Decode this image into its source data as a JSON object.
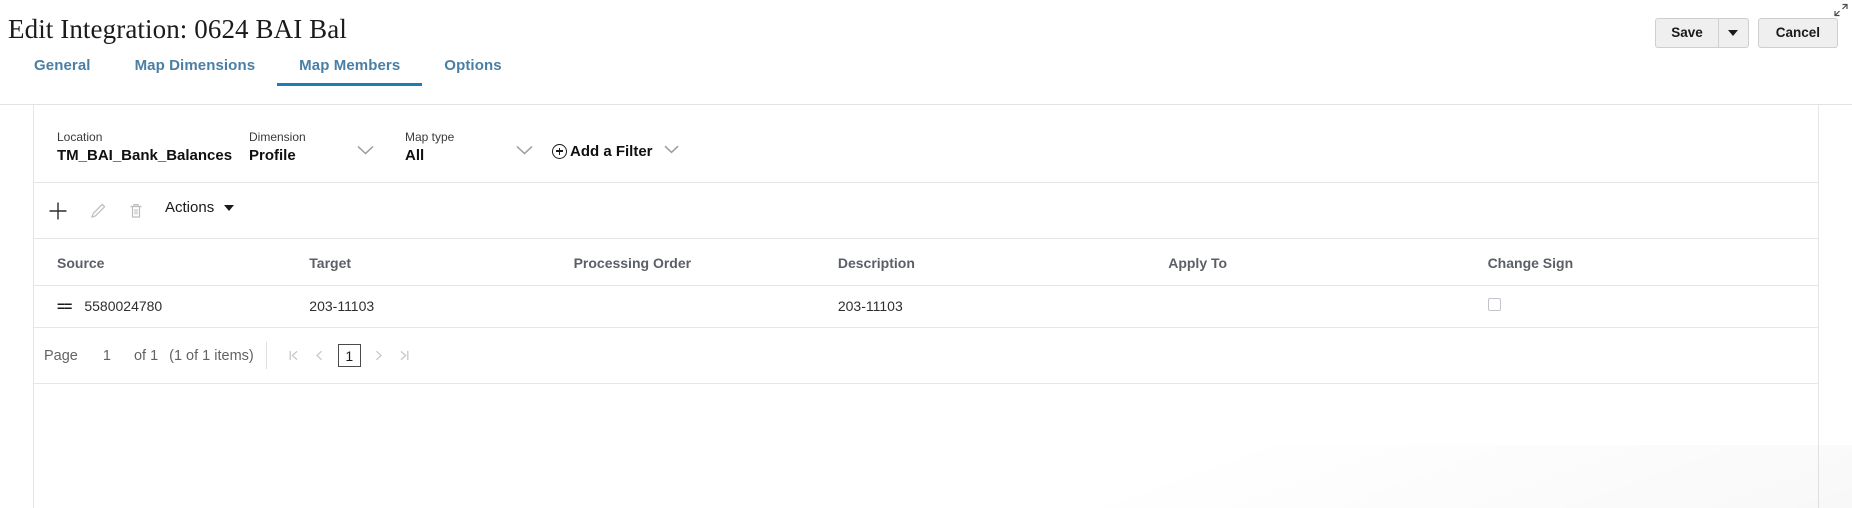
{
  "header": {
    "title": "Edit Integration: 0624 BAI Bal",
    "save_label": "Save",
    "save_dropdown_icon": "chevron-down-icon",
    "cancel_label": "Cancel",
    "resize_icon": "resize-diagonal-icon"
  },
  "tabs": [
    {
      "label": "General",
      "active": false
    },
    {
      "label": "Map Dimensions",
      "active": false
    },
    {
      "label": "Map Members",
      "active": true
    },
    {
      "label": "Options",
      "active": false
    }
  ],
  "filter_bar": {
    "location": {
      "label": "Location",
      "value": "TM_BAI_Bank_Balances"
    },
    "dimension": {
      "label": "Dimension",
      "value": "Profile",
      "icon": "chevron-down-icon"
    },
    "map_type": {
      "label": "Map type",
      "value": "All",
      "icon": "chevron-down-icon"
    },
    "add_filter": {
      "label": "Add a Filter",
      "plus_icon": "plus-circle-icon",
      "chevron_icon": "chevron-down-icon"
    }
  },
  "toolbar": {
    "add_icon": "plus-icon",
    "edit_icon": "pencil-icon",
    "delete_icon": "trash-icon",
    "actions_label": "Actions",
    "actions_icon": "caret-down-icon"
  },
  "table": {
    "columns": [
      "Source",
      "Target",
      "Processing Order",
      "Description",
      "Apply To",
      "Change Sign"
    ],
    "rows": [
      {
        "operator": "==",
        "source": "5580024780",
        "target": "203-11103",
        "processing_order": "",
        "description": "203-11103",
        "apply_to": "",
        "change_sign_checked": false
      }
    ]
  },
  "pagination": {
    "page_word": "Page",
    "page_number": "1",
    "of_text": "of 1",
    "items_text": "(1 of 1 items)",
    "first_icon": "first-page-icon",
    "prev_icon": "previous-page-icon",
    "current_page": "1",
    "next_icon": "next-page-icon",
    "last_icon": "last-page-icon"
  },
  "colors": {
    "tab_text": "#4a7fa5",
    "tab_underline": "#1c7cb5",
    "border": "#e6e6e6",
    "header_text": "#5b5f66"
  }
}
